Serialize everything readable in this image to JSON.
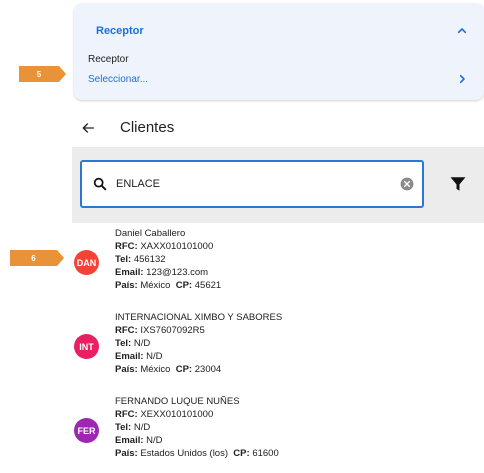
{
  "receptor": {
    "header": "Receptor",
    "label": "Receptor",
    "select_text": "Seleccionar..."
  },
  "markers": [
    "5",
    "6"
  ],
  "clients_header": {
    "title": "Clientes"
  },
  "search": {
    "value": "ENLACE"
  },
  "colors": {
    "accent": "#1e6fd9",
    "marker": "#e8923a"
  },
  "field_labels": {
    "rfc": "RFC:",
    "tel": "Tel:",
    "email": "Email:",
    "pais": "País:",
    "cp": "CP:"
  },
  "clients": [
    {
      "avatar": "DAN",
      "avatar_color": "#f44336",
      "name": "Daniel Caballero",
      "rfc": "XAXX010101000",
      "tel": "456132",
      "email": "123@123.com",
      "pais": "México",
      "cp": "45621"
    },
    {
      "avatar": "INT",
      "avatar_color": "#e91e63",
      "name": "INTERNACIONAL XIMBO Y SABORES",
      "rfc": "IXS7607092R5",
      "tel": "N/D",
      "email": "N/D",
      "pais": "México",
      "cp": "23004"
    },
    {
      "avatar": "FER",
      "avatar_color": "#9c27b0",
      "name": "FERNANDO LUQUE NUÑES",
      "rfc": "XEXX010101000",
      "tel": "N/D",
      "email": "N/D",
      "pais": "Estados Unidos (los)",
      "cp": "61600"
    }
  ]
}
